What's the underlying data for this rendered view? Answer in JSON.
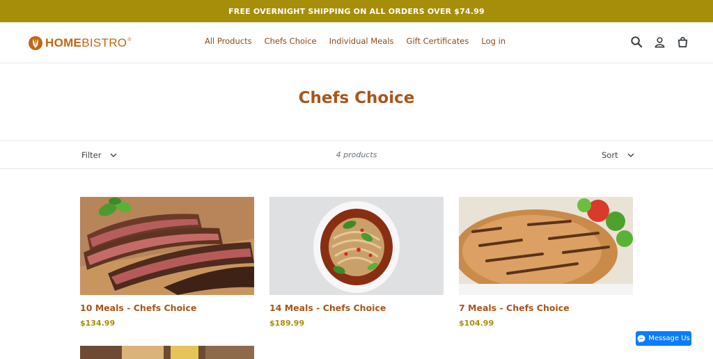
{
  "announcement": "FREE OVERNIGHT SHIPPING ON ALL ORDERS OVER $74.99",
  "brand": {
    "home": "HOME",
    "bistro": "BISTRO",
    "reg": "®",
    "color": "#c2660f"
  },
  "nav": [
    "All Products",
    "Chefs Choice",
    "Individual Meals",
    "Gift Certificates",
    "Log in"
  ],
  "header_icons": [
    "search-icon",
    "account-icon",
    "cart-icon"
  ],
  "collection_title": "Chefs Choice",
  "filter_label": "Filter",
  "sort_label": "Sort",
  "product_count": "4 products",
  "products": [
    {
      "name": "10 Meals - Chefs Choice",
      "price": "$134.99",
      "image": "sliced-steak"
    },
    {
      "name": "14 Meals - Chefs Choice",
      "price": "$189.99",
      "image": "noodle-soup"
    },
    {
      "name": "7 Meals - Chefs Choice",
      "price": "$104.99",
      "image": "grilled-chicken"
    }
  ],
  "messenger_label": "Message Us",
  "colors": {
    "announce_bg": "#a68e0a",
    "title": "#a8551a",
    "price": "#a68e0a",
    "messenger": "#0a7cff"
  }
}
